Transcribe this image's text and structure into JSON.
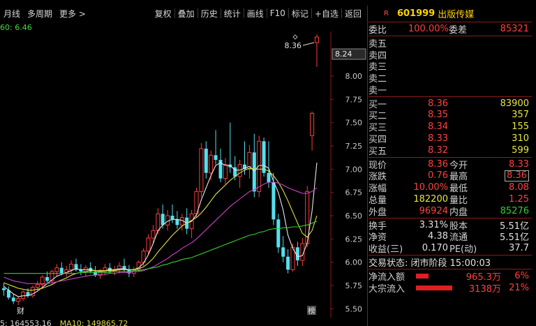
{
  "toolbar": {
    "left": [
      "月线",
      "多周期",
      "更多 >"
    ],
    "right": [
      "复权",
      "叠加",
      "历史",
      "统计",
      "画线",
      "F10",
      "标记",
      "+自选",
      "返回"
    ]
  },
  "ma_header": "60: 6.46",
  "price_axis": [
    "8.00",
    "7.75",
    "7.50",
    "7.25",
    "7.00",
    "6.75",
    "6.50",
    "6.25",
    "6.00",
    "5.75",
    "5.50"
  ],
  "price_box": "8.24",
  "last_price_label": "8.36",
  "bottom_bar": {
    "vol": "5: 164553.16",
    "ma10": "MA10: 149865.72"
  },
  "markers": {
    "cai": "财",
    "bang": "榜"
  },
  "chart_data": {
    "type": "candlestick",
    "ylim": [
      5.45,
      8.45
    ],
    "y_ticks": [
      8.0,
      7.75,
      7.5,
      7.25,
      7.0,
      6.75,
      6.5,
      6.25,
      6.0,
      5.75,
      5.5
    ],
    "candles": [
      [
        5.72,
        5.78,
        5.64,
        5.7
      ],
      [
        5.7,
        5.74,
        5.6,
        5.62
      ],
      [
        5.62,
        5.66,
        5.55,
        5.58
      ],
      [
        5.58,
        5.63,
        5.54,
        5.61
      ],
      [
        5.61,
        5.7,
        5.58,
        5.68
      ],
      [
        5.68,
        5.72,
        5.62,
        5.64
      ],
      [
        5.64,
        5.75,
        5.62,
        5.73
      ],
      [
        5.73,
        5.8,
        5.69,
        5.76
      ],
      [
        5.76,
        5.86,
        5.72,
        5.84
      ],
      [
        5.84,
        5.9,
        5.78,
        5.8
      ],
      [
        5.8,
        5.92,
        5.77,
        5.9
      ],
      [
        5.9,
        5.98,
        5.85,
        5.94
      ],
      [
        5.94,
        6.0,
        5.86,
        5.88
      ],
      [
        5.88,
        5.96,
        5.84,
        5.92
      ],
      [
        5.92,
        6.02,
        5.88,
        5.98
      ],
      [
        5.98,
        6.04,
        5.9,
        5.92
      ],
      [
        5.92,
        5.98,
        5.86,
        5.9
      ],
      [
        5.9,
        5.97,
        5.85,
        5.94
      ],
      [
        5.94,
        6.0,
        5.88,
        5.9
      ],
      [
        5.9,
        5.96,
        5.84,
        5.86
      ],
      [
        5.86,
        5.93,
        5.82,
        5.9
      ],
      [
        5.9,
        5.98,
        5.86,
        5.94
      ],
      [
        5.94,
        5.99,
        5.88,
        5.9
      ],
      [
        5.9,
        5.96,
        5.86,
        5.92
      ],
      [
        5.92,
        6.0,
        5.88,
        5.96
      ],
      [
        5.96,
        6.04,
        5.9,
        5.92
      ],
      [
        5.92,
        5.97,
        5.84,
        5.88
      ],
      [
        5.88,
        5.95,
        5.84,
        5.92
      ],
      [
        5.92,
        6.02,
        5.9,
        6.0
      ],
      [
        6.0,
        6.15,
        5.96,
        6.12
      ],
      [
        6.12,
        6.3,
        6.08,
        6.26
      ],
      [
        6.26,
        6.4,
        6.2,
        6.34
      ],
      [
        6.34,
        6.58,
        6.3,
        6.52
      ],
      [
        6.52,
        6.62,
        6.36,
        6.4
      ],
      [
        6.4,
        6.56,
        6.34,
        6.5
      ],
      [
        6.5,
        6.62,
        6.42,
        6.46
      ],
      [
        6.46,
        6.55,
        6.36,
        6.4
      ],
      [
        6.4,
        6.52,
        6.34,
        6.48
      ],
      [
        6.48,
        6.58,
        6.3,
        6.36
      ],
      [
        6.36,
        6.56,
        6.26,
        6.52
      ],
      [
        6.52,
        6.8,
        6.48,
        6.76
      ],
      [
        6.76,
        7.28,
        6.7,
        7.22
      ],
      [
        7.22,
        7.3,
        6.9,
        6.96
      ],
      [
        6.96,
        7.2,
        6.88,
        7.15
      ],
      [
        7.15,
        7.42,
        7.05,
        7.1
      ],
      [
        7.1,
        7.22,
        6.86,
        6.9
      ],
      [
        6.9,
        7.12,
        6.84,
        7.05
      ],
      [
        7.05,
        7.5,
        6.96,
        7.02
      ],
      [
        7.02,
        7.14,
        6.88,
        6.92
      ],
      [
        6.92,
        7.1,
        6.8,
        7.05
      ],
      [
        7.05,
        7.3,
        6.94,
        7.0
      ],
      [
        7.0,
        7.26,
        6.9,
        7.18
      ],
      [
        7.18,
        7.38,
        6.7,
        6.76
      ],
      [
        6.76,
        7.36,
        6.7,
        7.3
      ],
      [
        7.3,
        7.34,
        6.92,
        6.96
      ],
      [
        6.96,
        7.3,
        6.8,
        6.86
      ],
      [
        6.86,
        6.96,
        6.4,
        6.46
      ],
      [
        6.46,
        6.52,
        6.1,
        6.16
      ],
      [
        6.16,
        6.28,
        6.0,
        6.06
      ],
      [
        6.06,
        6.14,
        5.88,
        5.92
      ],
      [
        5.92,
        6.2,
        5.9,
        6.16
      ],
      [
        6.16,
        6.22,
        5.96,
        6.02
      ],
      [
        6.02,
        6.26,
        5.96,
        6.2
      ],
      [
        6.2,
        6.82,
        6.16,
        6.76
      ],
      [
        7.36,
        7.62,
        7.2,
        7.6
      ],
      [
        8.36,
        8.45,
        8.1,
        8.42
      ]
    ],
    "ma_series": [
      {
        "color": "#e8e8e8",
        "values": [
          5.74,
          5.7,
          5.66,
          5.63,
          5.64,
          5.64,
          5.66,
          5.69,
          5.73,
          5.77,
          5.81,
          5.85,
          5.87,
          5.89,
          5.91,
          5.93,
          5.92,
          5.92,
          5.92,
          5.91,
          5.9,
          5.91,
          5.92,
          5.92,
          5.93,
          5.93,
          5.92,
          5.92,
          5.94,
          5.99,
          6.08,
          6.2,
          6.34,
          6.4,
          6.44,
          6.46,
          6.46,
          6.45,
          6.42,
          6.44,
          6.51,
          6.67,
          6.8,
          6.93,
          7.04,
          7.07,
          7.04,
          7.04,
          6.99,
          6.99,
          7.01,
          7.03,
          6.98,
          7.04,
          7.04,
          7.01,
          6.87,
          6.75,
          6.56,
          6.29,
          6.15,
          6.06,
          6.07,
          6.21,
          6.55,
          7.07
        ]
      },
      {
        "color": "#e0e040",
        "values": [
          5.78,
          5.76,
          5.74,
          5.72,
          5.71,
          5.7,
          5.7,
          5.71,
          5.72,
          5.74,
          5.76,
          5.79,
          5.81,
          5.83,
          5.86,
          5.88,
          5.89,
          5.9,
          5.91,
          5.91,
          5.91,
          5.91,
          5.91,
          5.91,
          5.92,
          5.92,
          5.92,
          5.92,
          5.93,
          5.95,
          5.99,
          6.04,
          6.11,
          6.17,
          6.23,
          6.29,
          6.34,
          6.39,
          6.42,
          6.45,
          6.48,
          6.53,
          6.59,
          6.66,
          6.73,
          6.78,
          6.83,
          6.88,
          6.92,
          6.96,
          6.99,
          7.01,
          7.0,
          7.0,
          7.0,
          6.98,
          6.93,
          6.86,
          6.77,
          6.66,
          6.54,
          6.42,
          6.31,
          6.27,
          6.34,
          6.5
        ]
      },
      {
        "color": "#d040d0",
        "values": [
          5.84,
          5.82,
          5.8,
          5.79,
          5.78,
          5.77,
          5.77,
          5.77,
          5.77,
          5.77,
          5.78,
          5.79,
          5.8,
          5.81,
          5.82,
          5.83,
          5.84,
          5.85,
          5.86,
          5.86,
          5.87,
          5.87,
          5.88,
          5.88,
          5.89,
          5.89,
          5.89,
          5.9,
          5.9,
          5.91,
          5.93,
          5.95,
          5.98,
          6.01,
          6.04,
          6.08,
          6.11,
          6.15,
          6.18,
          6.21,
          6.25,
          6.3,
          6.35,
          6.4,
          6.45,
          6.5,
          6.55,
          6.6,
          6.64,
          6.68,
          6.72,
          6.76,
          6.78,
          6.81,
          6.84,
          6.86,
          6.86,
          6.85,
          6.83,
          6.8,
          6.78,
          6.76,
          6.74,
          6.74,
          6.76,
          6.8
        ]
      },
      {
        "color": "#30d030",
        "values": [
          5.88,
          5.88,
          5.88,
          5.88,
          5.88,
          5.88,
          5.88,
          5.88,
          5.88,
          5.88,
          5.88,
          5.88,
          5.88,
          5.88,
          5.88,
          5.88,
          5.89,
          5.89,
          5.89,
          5.89,
          5.89,
          5.89,
          5.89,
          5.9,
          5.9,
          5.9,
          5.9,
          5.91,
          5.91,
          5.92,
          5.93,
          5.94,
          5.95,
          5.97,
          5.98,
          6.0,
          6.01,
          6.03,
          6.04,
          6.05,
          6.07,
          6.09,
          6.11,
          6.13,
          6.15,
          6.17,
          6.19,
          6.21,
          6.23,
          6.25,
          6.27,
          6.29,
          6.3,
          6.32,
          6.33,
          6.35,
          6.36,
          6.36,
          6.37,
          6.37,
          6.38,
          6.38,
          6.39,
          6.4,
          6.42,
          6.44
        ]
      }
    ]
  },
  "quote": {
    "code": "601999",
    "name": "出版传媒",
    "badge": "R",
    "weibi_label": "委比",
    "weibi": "100.00%",
    "weicha_label": "委差",
    "weicha": "85321",
    "sells": [
      "卖五",
      "卖四",
      "卖三",
      "卖二",
      "卖一"
    ],
    "buys": [
      {
        "label": "买一",
        "price": "8.36",
        "vol": "83900"
      },
      {
        "label": "买二",
        "price": "8.35",
        "vol": "357"
      },
      {
        "label": "买三",
        "price": "8.34",
        "vol": "155"
      },
      {
        "label": "买四",
        "price": "8.33",
        "vol": "310"
      },
      {
        "label": "买五",
        "price": "8.32",
        "vol": "599"
      }
    ],
    "stats1": [
      {
        "l1": "现价",
        "v1": "8.36",
        "l2": "今开",
        "v2": "8.33"
      },
      {
        "l1": "涨跌",
        "v1": "0.76",
        "l2": "最高",
        "v2": "8.36"
      },
      {
        "l1": "涨幅",
        "v1": "10.00%",
        "l2": "最低",
        "v2": "8.08"
      },
      {
        "l1": "总量",
        "v1": "182200",
        "l2": "量比",
        "v2": "1.25"
      },
      {
        "l1": "外盘",
        "v1": "96924",
        "l2": "内盘",
        "v2": "85276"
      }
    ],
    "stats2": [
      {
        "l1": "换手",
        "v1": "3.31%",
        "l2": "股本",
        "v2": "5.51亿"
      },
      {
        "l1": "净资",
        "v1": "4.38",
        "l2": "流通",
        "v2": "5.51亿"
      },
      {
        "l1": "收益(三)",
        "v1": "0.170",
        "l2": "PE(动)",
        "v2": "37.7"
      }
    ],
    "trade_state": "交易状态: 闭市阶段 15:00:03",
    "flows": [
      {
        "label": "净流入额",
        "value": "965.3万",
        "pct": "6%"
      },
      {
        "label": "大宗流入",
        "value": "3138万",
        "pct": "21%"
      }
    ]
  }
}
